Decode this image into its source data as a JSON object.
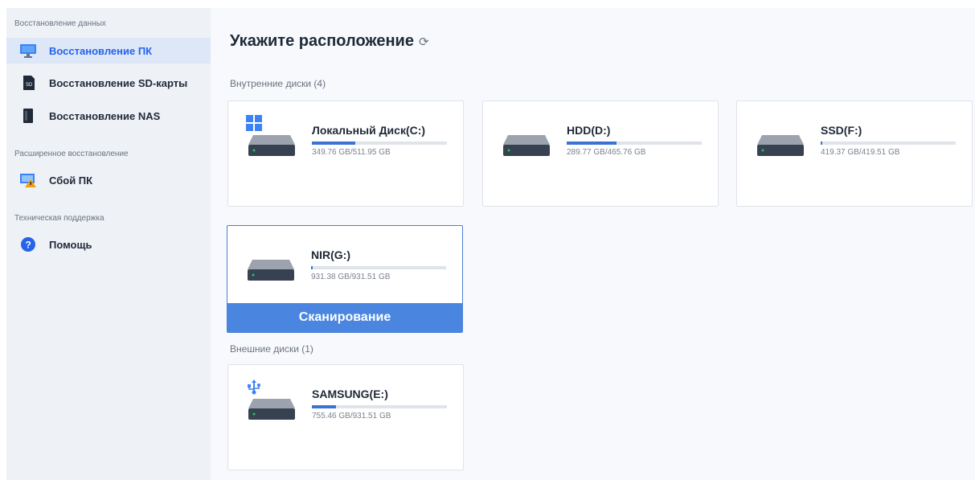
{
  "sidebar": {
    "sections": [
      {
        "label": "Восстановление данных"
      },
      {
        "label": "Расширенное восстановление"
      },
      {
        "label": "Техническая поддержка"
      }
    ],
    "items": [
      {
        "label": "Восстановление ПК",
        "icon": "monitor-icon",
        "active": true
      },
      {
        "label": "Восстановление SD-карты",
        "icon": "sd-card-icon"
      },
      {
        "label": "Восстановление NAS",
        "icon": "nas-icon"
      },
      {
        "label": "Сбой ПК",
        "icon": "pc-crash-icon"
      },
      {
        "label": "Помощь",
        "icon": "help-icon"
      }
    ]
  },
  "main": {
    "title": "Укажите расположение",
    "refresh_icon": "refresh-icon",
    "internal_label": "Внутренние диски (4)",
    "external_label": "Внешние диски (1)",
    "scan_label": "Сканирование",
    "drives": [
      {
        "name": "Локальный Диск(C:)",
        "size": "349.76 GB/511.95 GB",
        "fill": 0.32,
        "icon": "windows-icon"
      },
      {
        "name": "HDD(D:)",
        "size": "289.77 GB/465.76 GB",
        "fill": 0.37
      },
      {
        "name": "SSD(F:)",
        "size": "419.37 GB/419.51 GB",
        "fill": 0.01
      },
      {
        "name": "NIR(G:)",
        "size": "931.38 GB/931.51 GB",
        "fill": 0.01,
        "selected": true
      },
      {
        "name": "SAMSUNG(E:)",
        "size": "755.46 GB/931.51 GB",
        "fill": 0.18,
        "icon": "usb-icon"
      }
    ]
  },
  "colors": {
    "accent": "#4a86e0",
    "bar": "#3a73d3",
    "sidebar": "#eef1f6",
    "active": "#dde7f8"
  }
}
